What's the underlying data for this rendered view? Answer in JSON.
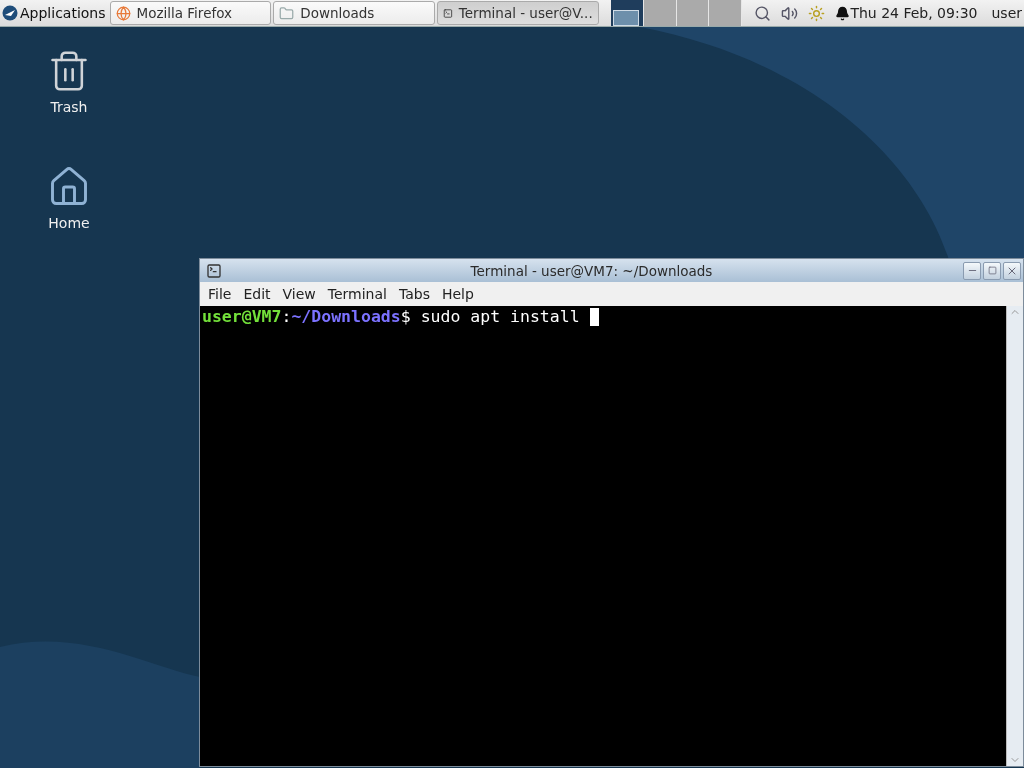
{
  "panel": {
    "menu": "Applications",
    "tasks": [
      {
        "label": "Mozilla Firefox",
        "kind": "browser",
        "selected": false
      },
      {
        "label": "Downloads",
        "kind": "folder",
        "selected": false
      },
      {
        "label": "Terminal - user@V...",
        "kind": "terminal",
        "selected": true
      }
    ],
    "workspaces": [
      {
        "selected": true
      },
      {
        "selected": false
      },
      {
        "selected": false
      },
      {
        "selected": false
      }
    ],
    "clock": "Thu 24 Feb, 09:30",
    "user": "user"
  },
  "desktop_icons": [
    {
      "label": "Trash",
      "kind": "trash"
    },
    {
      "label": "Home",
      "kind": "home"
    }
  ],
  "terminal": {
    "title": "Terminal - user@VM7: ~/Downloads",
    "menu": [
      "File",
      "Edit",
      "View",
      "Terminal",
      "Tabs",
      "Help"
    ],
    "prompt_user": "user@VM7",
    "prompt_sep": ":",
    "prompt_path": "~/Downloads",
    "prompt_symbol": "$",
    "command": "sudo apt install"
  }
}
